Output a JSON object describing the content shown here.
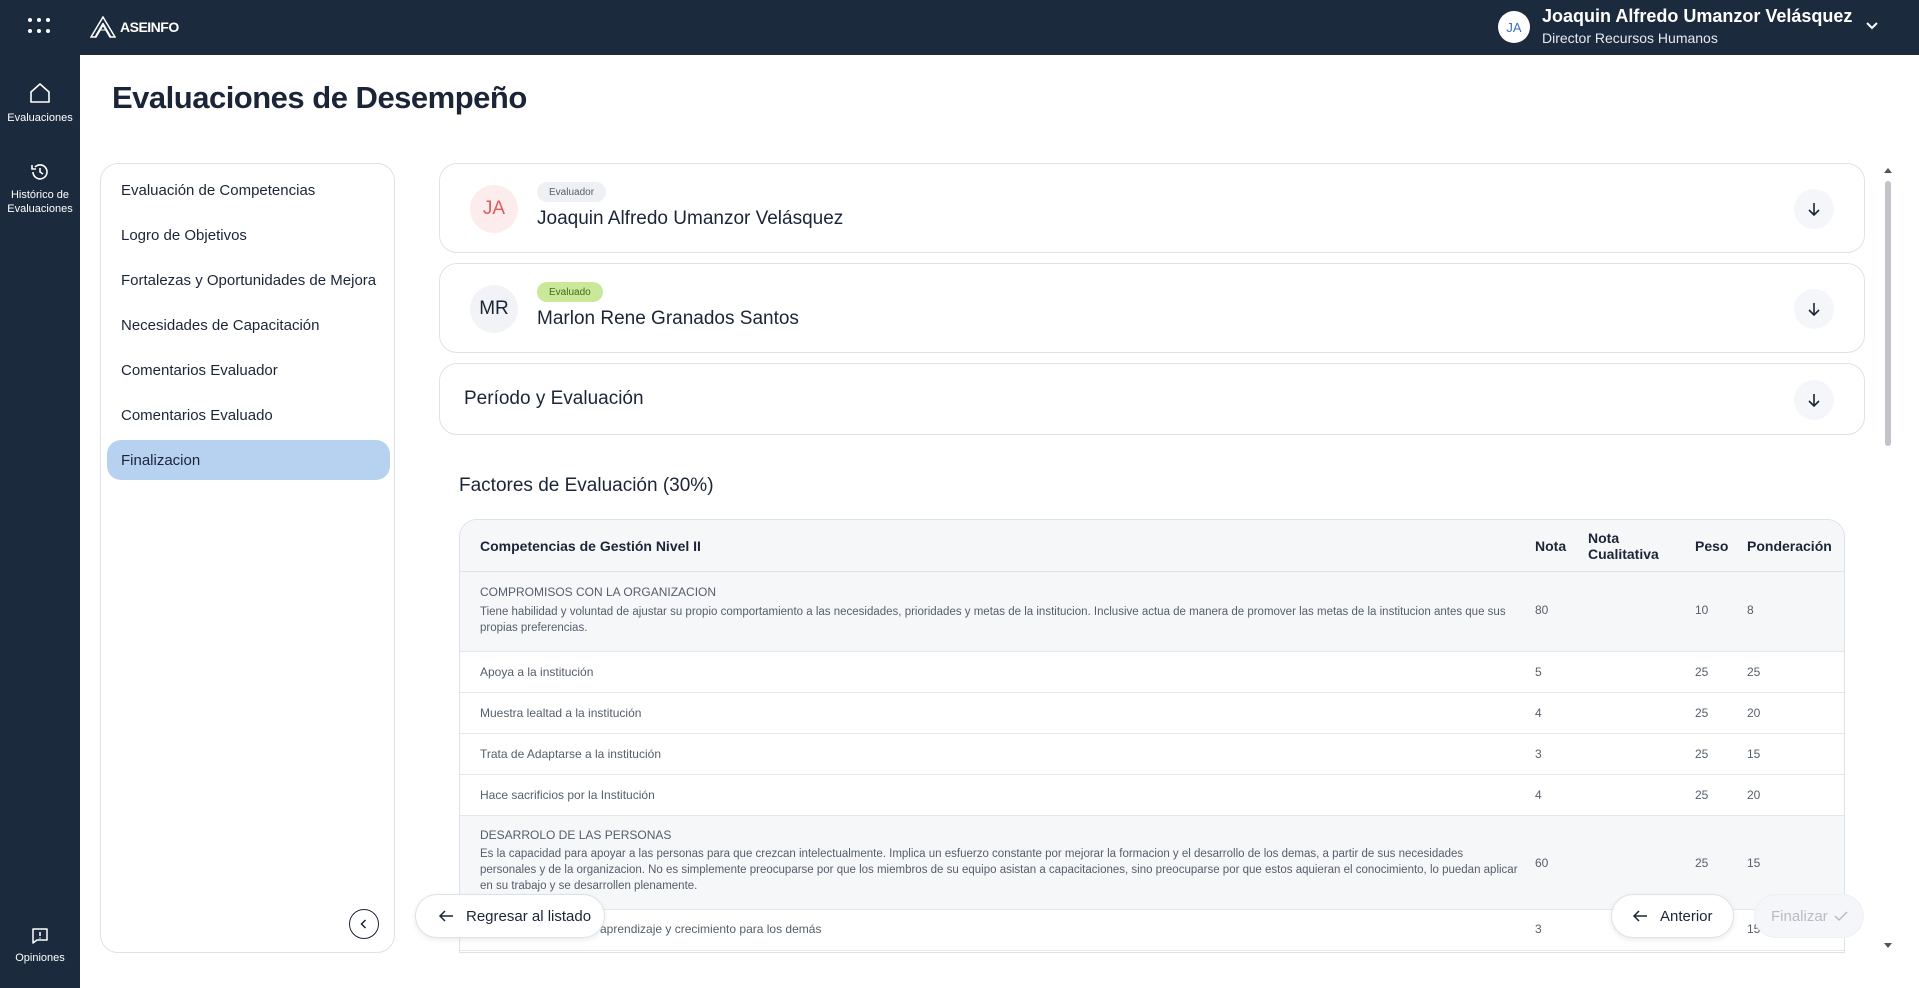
{
  "topbar": {
    "brand": "ASEINFO",
    "user_initials": "JA",
    "user_name": "Joaquin Alfredo Umanzor Velásquez",
    "user_role": "Director Recursos Humanos"
  },
  "rail": {
    "items": [
      {
        "label": "Evaluaciones",
        "icon": "home-icon"
      },
      {
        "label": "Histórico de Evaluaciones",
        "icon": "history-icon"
      },
      {
        "label": "Opiniones",
        "icon": "feedback-icon"
      }
    ]
  },
  "page": {
    "title": "Evaluaciones de Desempeño"
  },
  "sidenav": {
    "items": [
      {
        "label": "Evaluación de Competencias"
      },
      {
        "label": "Logro de Objetivos"
      },
      {
        "label": "Fortalezas y Oportunidades de Mejora"
      },
      {
        "label": "Necesidades de Capacitación"
      },
      {
        "label": "Comentarios Evaluador"
      },
      {
        "label": "Comentarios Evaluado"
      },
      {
        "label": "Finalizacion"
      }
    ],
    "active": "Finalizacion"
  },
  "evaluator": {
    "badge": "Evaluador",
    "initials": "JA",
    "name": "Joaquin Alfredo Umanzor Velásquez"
  },
  "evaluated": {
    "badge": "Evaluado",
    "initials": "MR",
    "name": "Marlon Rene Granados Santos"
  },
  "period": {
    "title": "Período y Evaluación"
  },
  "factors": {
    "title": "Factores de Evaluación (30%)",
    "headers": {
      "competencia": "Competencias de Gestión Nivel II",
      "nota": "Nota",
      "nota_cualitativa_1": "Nota",
      "nota_cualitativa_2": "Cualitativa",
      "peso": "Peso",
      "ponderacion": "Ponderación"
    },
    "groups": [
      {
        "title": "COMPROMISOS CON LA ORGANIZACION",
        "desc": "Tiene habilidad y voluntad de ajustar su propio comportamiento a las necesidades, prioridades y metas de la institucion. Inclusive actua de manera de promover las metas de la institucion antes que sus propias preferencias.",
        "nota": "80",
        "peso": "10",
        "ponderacion": "8"
      },
      {
        "title": "DESARROLO DE LAS PERSONAS",
        "desc": "Es la capacidad para apoyar a las personas para que crezcan intelectualmente. Implica un esfuerzo constante por mejorar la formacion y el desarrollo de los demas, a partir de sus necesidades personales y de la organizacion. No es simplemente preocuparse por que los miembros de su equipo asistan a capacitaciones, sino preocuparse por que estos aquieran el conocimiento, lo puedan aplicar en su trabajo y se desarrollen plenamente.",
        "nota": "60",
        "peso": "25",
        "ponderacion": "15"
      }
    ],
    "rows": [
      {
        "label": "Apoya a la institución",
        "nota": "5",
        "peso": "25",
        "ponderacion": "25"
      },
      {
        "label": "Muestra lealtad a la institución",
        "nota": "4",
        "peso": "25",
        "ponderacion": "20"
      },
      {
        "label": "Trata de Adaptarse a la institución",
        "nota": "3",
        "peso": "25",
        "ponderacion": "15"
      },
      {
        "label": "Hace sacrificios por la Institución",
        "nota": "4",
        "peso": "25",
        "ponderacion": "20"
      },
      {
        "label": "aprendizaje y crecimiento para los demás",
        "nota": "3",
        "peso": "",
        "ponderacion": "15"
      }
    ]
  },
  "actions": {
    "back": "Regresar al listado",
    "previous": "Anterior",
    "finish": "Finalizar"
  },
  "colors": {
    "navy": "#1b2a3c",
    "active_nav": "#b7d1f0",
    "evaluado_badge": "#c9e89a",
    "evaluador_badge": "#eef0f3",
    "ja_avatar_text": "#e05a5a"
  }
}
